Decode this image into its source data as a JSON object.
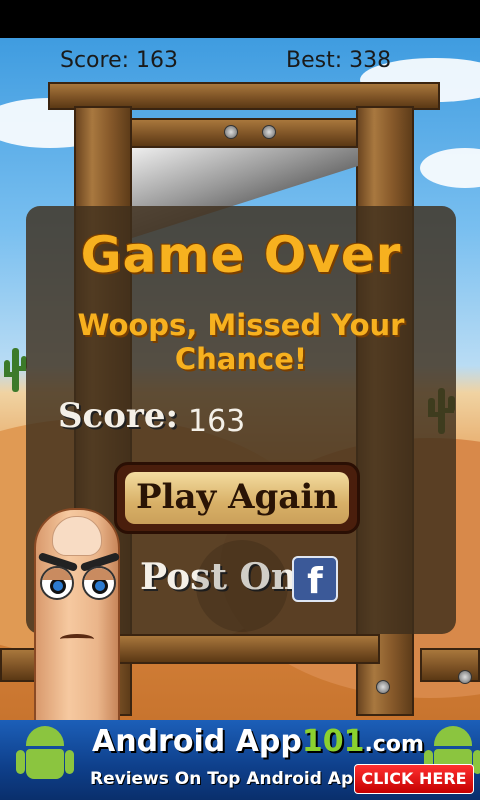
{
  "hud": {
    "score_label": "Score: 163",
    "best_label": "Best: 338"
  },
  "game_over": {
    "title": "Game Over",
    "subtitle": "Woops, Missed Your Chance!",
    "score_label": "Score:",
    "score_value": "163",
    "play_again_label": "Play Again",
    "post_on_label": "Post On",
    "facebook_glyph": "f"
  },
  "ad": {
    "title_part1": "Android App",
    "title_part2": "101",
    "title_part3": ".com",
    "subtitle": "Reviews On Top Android Apps",
    "button_label": "CLICK HERE"
  },
  "colors": {
    "title_orange": "#f7b11f",
    "facebook_blue": "#3b5998",
    "ad_blue": "#0e3f8a",
    "android_green": "#8bc53f",
    "click_red": "#e00000"
  },
  "icons": [
    "facebook-icon",
    "cactus-icon",
    "android-icon"
  ]
}
